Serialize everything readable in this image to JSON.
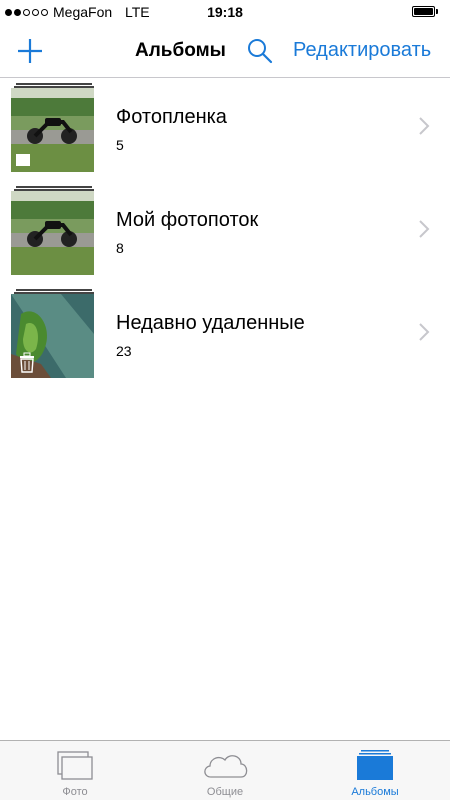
{
  "status_bar": {
    "carrier": "MegaFon",
    "network": "LTE",
    "time": "19:18",
    "signal_dots_filled": 2,
    "signal_dots_total": 5,
    "battery_level": 1.0
  },
  "nav": {
    "title": "Альбомы",
    "edit_label": "Редактировать",
    "add_icon": "plus-icon",
    "search_icon": "search-icon"
  },
  "albums": [
    {
      "name": "Фотопленка",
      "count": "5",
      "badge_icon": "camera-roll-icon"
    },
    {
      "name": "Мой фотопоток",
      "count": "8",
      "badge_icon": ""
    },
    {
      "name": "Недавно удаленные",
      "count": "23",
      "badge_icon": "trash-icon"
    }
  ],
  "tab_bar": {
    "tabs": [
      {
        "label": "Фото",
        "icon": "photos-icon",
        "active": false
      },
      {
        "label": "Общие",
        "icon": "cloud-icon",
        "active": false
      },
      {
        "label": "Альбомы",
        "icon": "albums-icon",
        "active": true
      }
    ]
  },
  "colors": {
    "accent": "#1a7ad8",
    "inactive": "#8e8e93",
    "separator": "#c8c7cc",
    "tab_bar_bg": "#f7f7f7"
  }
}
